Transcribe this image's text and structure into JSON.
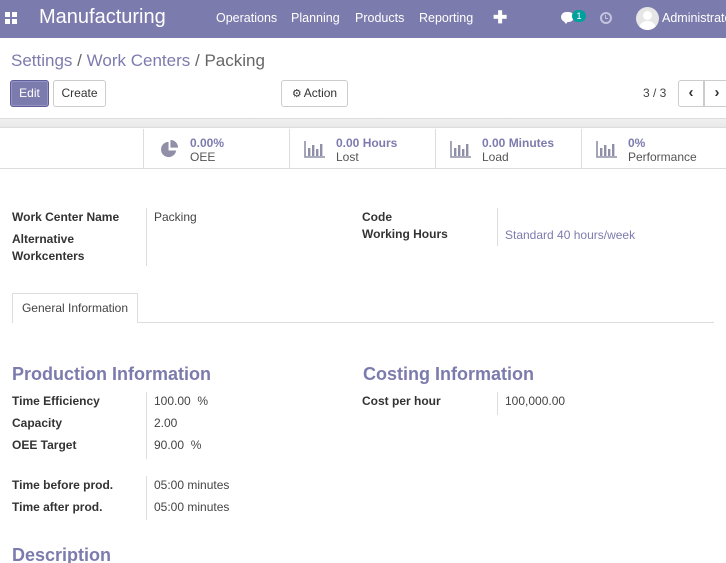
{
  "navbar": {
    "app_title": "Manufacturing",
    "menus": [
      "Operations",
      "Planning",
      "Products",
      "Reporting"
    ],
    "plus_label": "✚",
    "chat_count": "1",
    "user": "Administrator",
    "bg_color": "#7c7bad"
  },
  "breadcrumb": {
    "settings": "Settings",
    "work_centers": "Work Centers",
    "current": "Packing",
    "separator": "/"
  },
  "buttons": {
    "edit": "Edit",
    "create": "Create",
    "action": "Action"
  },
  "pager": {
    "value": "3 / 3",
    "prev": "‹",
    "next": "›"
  },
  "stats": [
    {
      "value": "0.00%",
      "label": "OEE",
      "icon": "pie-chart-icon"
    },
    {
      "value": "0.00 Hours",
      "label": "Lost",
      "icon": "bar-chart-icon"
    },
    {
      "value": "0.00 Minutes",
      "label": "Load",
      "icon": "bar-chart-icon"
    },
    {
      "value": "0%",
      "label": "Performance",
      "icon": "bar-chart-icon"
    }
  ],
  "form": {
    "work_center_name_label": "Work Center Name",
    "work_center_name_value": "Packing",
    "alternative_label": "Alternative Workcenters",
    "code_label": "Code",
    "working_hours_label": "Working Hours",
    "working_hours_value": "Standard 40 hours/week"
  },
  "tab": {
    "general": "General Information"
  },
  "production": {
    "title": "Production Information",
    "time_efficiency_label": "Time Efficiency",
    "time_efficiency_value": "100.00  %",
    "capacity_label": "Capacity",
    "capacity_value": "2.00",
    "oee_target_label": "OEE Target",
    "oee_target_value": "90.00  %",
    "time_before_label": "Time before prod.",
    "time_before_value": "05:00 minutes",
    "time_after_label": "Time after prod.",
    "time_after_value": "05:00 minutes"
  },
  "costing": {
    "title": "Costing Information",
    "cost_label": "Cost per hour",
    "cost_value": "100,000.00"
  },
  "description": {
    "title": "Description"
  }
}
